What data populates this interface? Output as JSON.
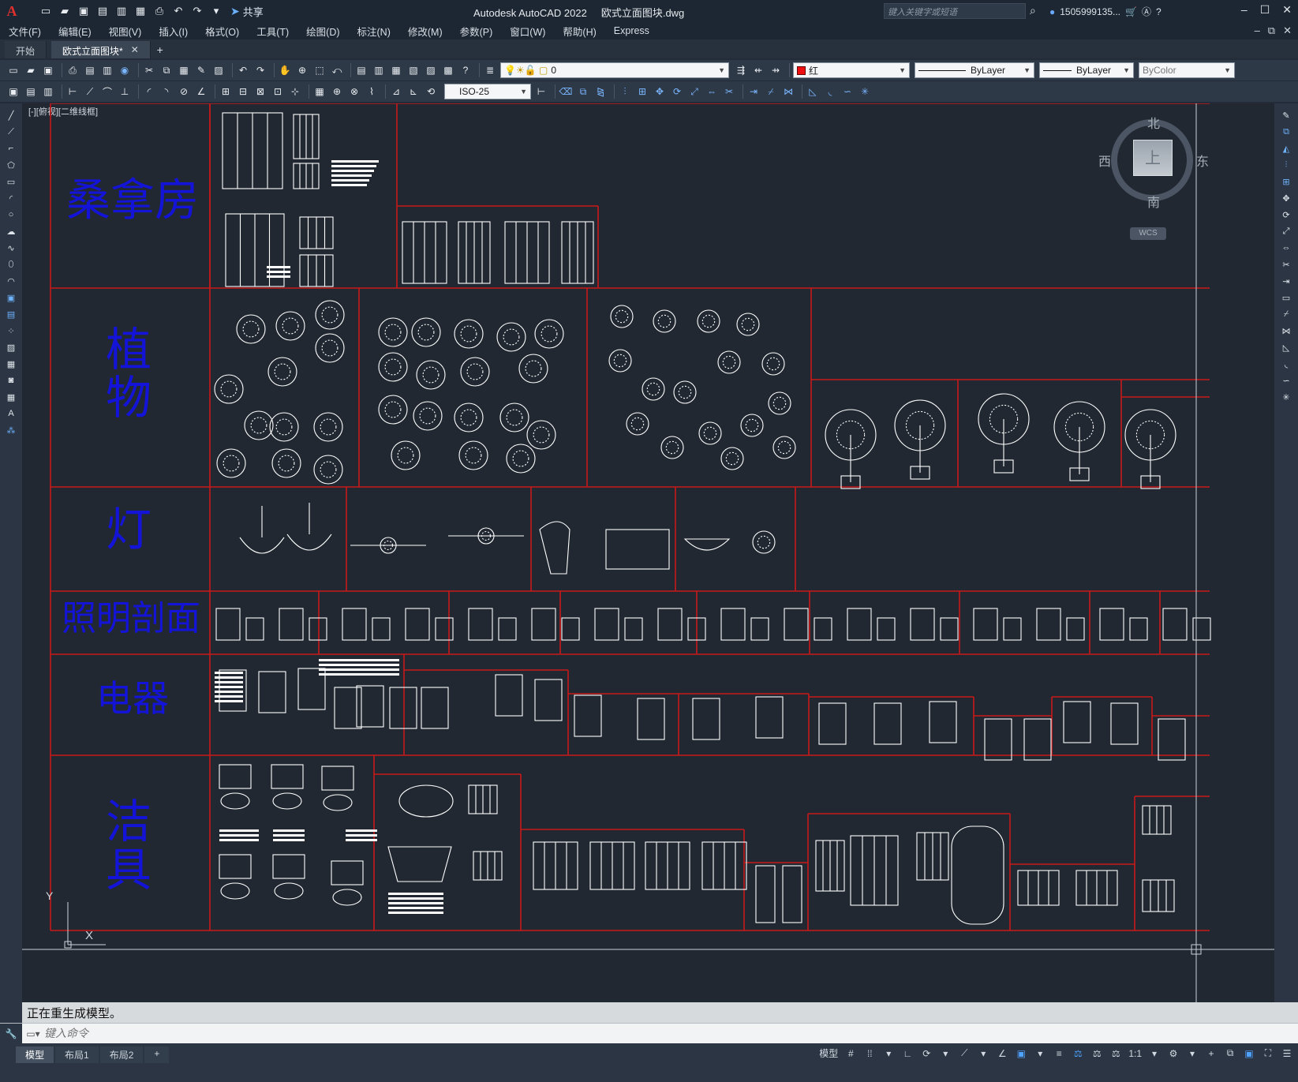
{
  "app": {
    "logo": "A",
    "title": "Autodesk AutoCAD 2022",
    "filename": "欧式立面图块.dwg",
    "share": "共享",
    "search_placeholder": "键入关键字或短语",
    "user": "1505999135...",
    "window_controls": [
      "–",
      "☐",
      "✕"
    ]
  },
  "menu": [
    "文件(F)",
    "编辑(E)",
    "视图(V)",
    "插入(I)",
    "格式(O)",
    "工具(T)",
    "绘图(D)",
    "标注(N)",
    "修改(M)",
    "参数(P)",
    "窗口(W)",
    "帮助(H)",
    "Express"
  ],
  "tabs": {
    "start": "开始",
    "active": "欧式立面图块*",
    "close": "✕",
    "add": "+"
  },
  "toolbar": {
    "layer": "0",
    "color": "红",
    "color_hex": "#ee1010",
    "linetype": "ByLayer",
    "lineweight": "ByLayer",
    "plotstyle": "ByColor",
    "dimstyle": "ISO-25"
  },
  "drawing": {
    "viewport_label": "[-][俯视][二维线框]",
    "rows": [
      {
        "label": "桑拿房"
      },
      {
        "label": "植物"
      },
      {
        "label": "灯"
      },
      {
        "label": "照明剖面"
      },
      {
        "label": "电器"
      },
      {
        "label": "洁具"
      }
    ],
    "ucs": {
      "x": "X",
      "y": "Y"
    },
    "accent_color": "#d01818",
    "label_color": "#1414d8"
  },
  "viewcube": {
    "north": "北",
    "south": "南",
    "east": "东",
    "west": "西",
    "face": "上",
    "wcs": "WCS"
  },
  "command": {
    "history": "正在重生成模型。",
    "placeholder": "键入命令"
  },
  "status": {
    "layouts": [
      "模型",
      "布局1",
      "布局2"
    ],
    "add": "+",
    "model": "模型",
    "scale": "1:1"
  }
}
